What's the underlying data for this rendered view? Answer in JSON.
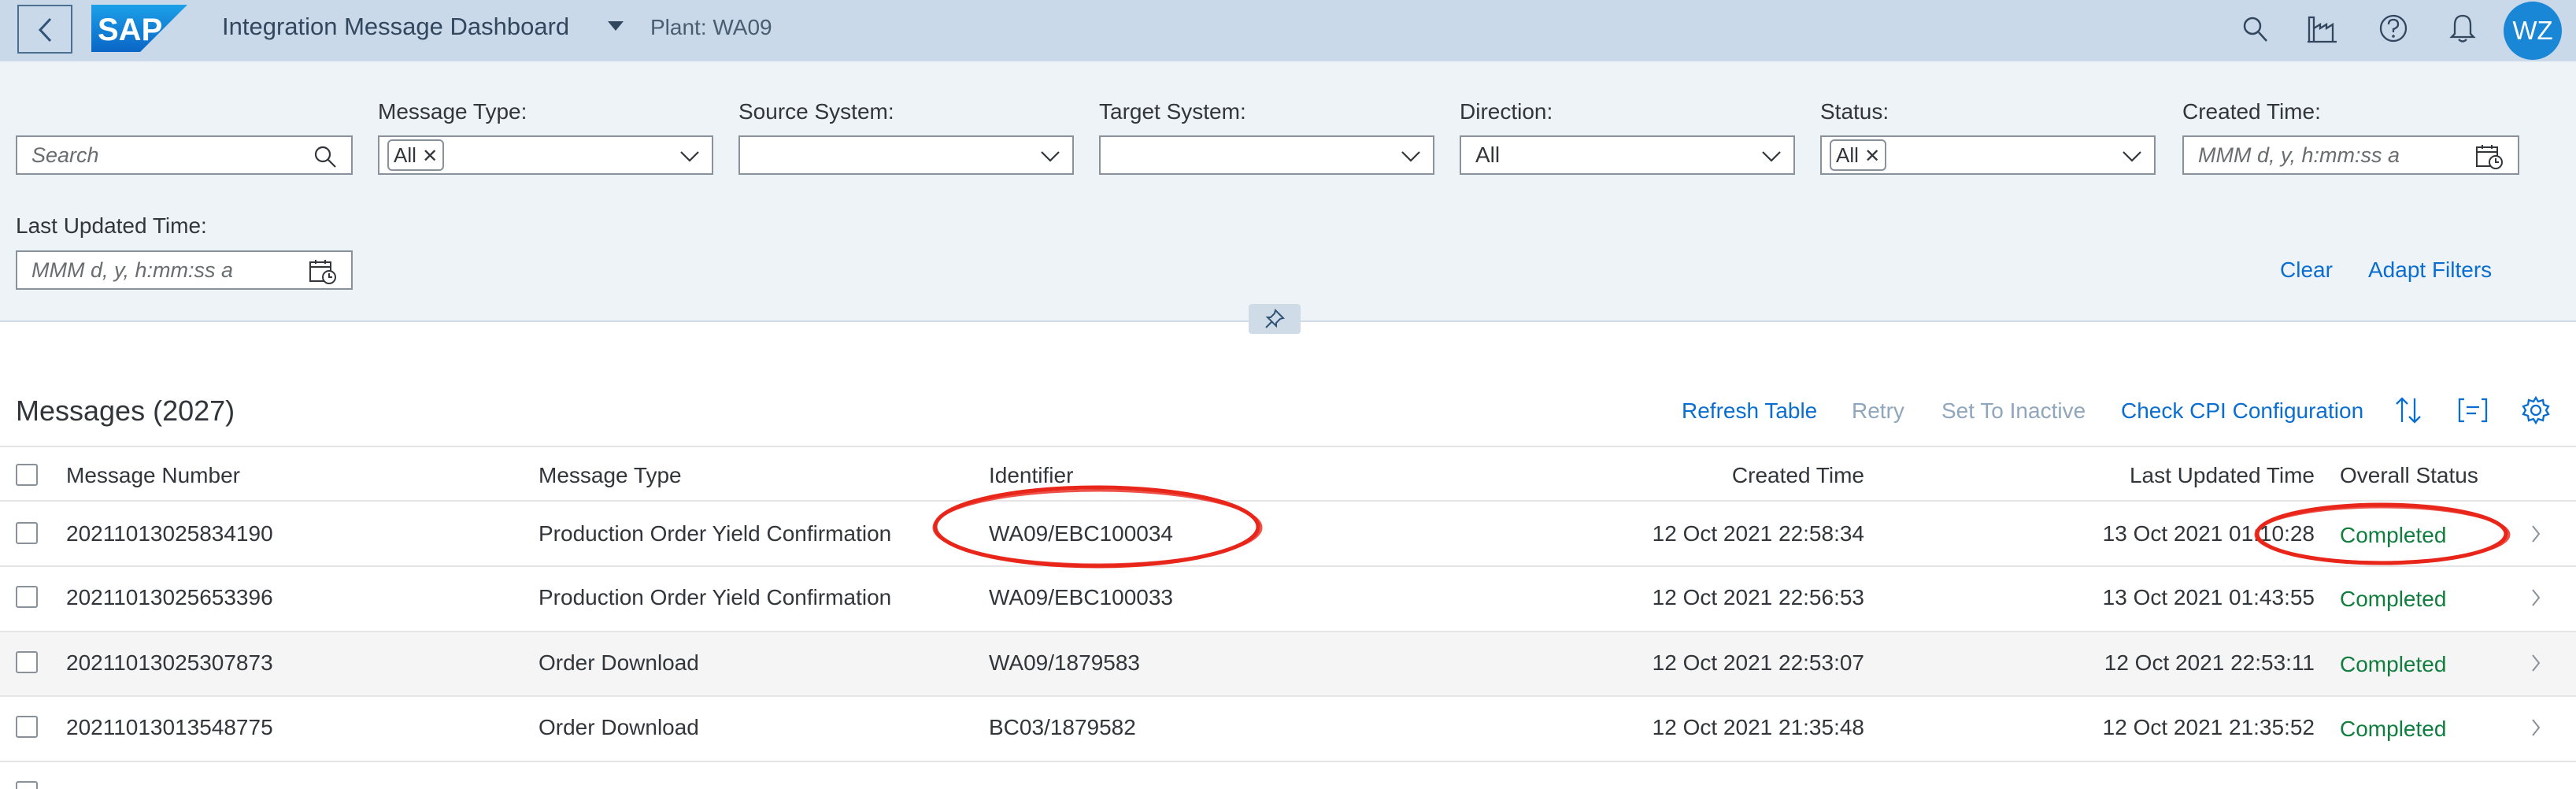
{
  "shell": {
    "logo_text": "SAP",
    "app_title": "Integration Message Dashboard",
    "plant": "Plant: WA09",
    "avatar_initials": "WZ"
  },
  "filters": {
    "search_placeholder": "Search",
    "message_type": {
      "label": "Message Type:",
      "token": "All"
    },
    "source_system": {
      "label": "Source System:"
    },
    "target_system": {
      "label": "Target System:"
    },
    "direction": {
      "label": "Direction:",
      "value": "All"
    },
    "status": {
      "label": "Status:",
      "token": "All"
    },
    "created_time": {
      "label": "Created Time:",
      "placeholder": "MMM d, y, h:mm:ss a"
    },
    "last_updated_time": {
      "label": "Last Updated Time:",
      "placeholder": "MMM d, y, h:mm:ss a"
    },
    "clear_label": "Clear",
    "adapt_label": "Adapt Filters"
  },
  "table": {
    "title": "Messages (2027)",
    "toolbar": {
      "refresh": "Refresh Table",
      "retry": "Retry",
      "set_inactive": "Set To Inactive",
      "check_cpi": "Check CPI Configuration"
    },
    "columns": {
      "number": "Message Number",
      "type": "Message Type",
      "identifier": "Identifier",
      "created": "Created Time",
      "updated": "Last Updated Time",
      "status": "Overall Status"
    },
    "rows": [
      {
        "number": "20211013025834190",
        "type": "Production Order Yield Confirmation",
        "identifier": "WA09/EBC100034",
        "created": "12 Oct 2021 22:58:34",
        "updated": "13 Oct 2021 01:10:28",
        "status": "Completed"
      },
      {
        "number": "20211013025653396",
        "type": "Production Order Yield Confirmation",
        "identifier": "WA09/EBC100033",
        "created": "12 Oct 2021 22:56:53",
        "updated": "13 Oct 2021 01:43:55",
        "status": "Completed"
      },
      {
        "number": "20211013025307873",
        "type": "Order Download",
        "identifier": "WA09/1879583",
        "created": "12 Oct 2021 22:53:07",
        "updated": "12 Oct 2021 22:53:11",
        "status": "Completed"
      },
      {
        "number": "20211013013548775",
        "type": "Order Download",
        "identifier": "BC03/1879582",
        "created": "12 Oct 2021 21:35:48",
        "updated": "12 Oct 2021 21:35:52",
        "status": "Completed"
      }
    ]
  },
  "colors": {
    "shell_bg": "#c9d9ea",
    "filterbar_bg": "#eef3f8",
    "link": "#0a6ed1",
    "status_success": "#107e3e",
    "annotation": "#e8261a",
    "avatar_bg": "#1a86d6"
  },
  "icons": [
    "back-icon",
    "search-icon",
    "factory-icon",
    "help-icon",
    "bell-icon",
    "calendar-icon",
    "pin-icon",
    "sort-icon",
    "group-icon",
    "settings-icon",
    "navigation-arrow-icon",
    "chevron-down-icon",
    "remove-token-icon"
  ]
}
